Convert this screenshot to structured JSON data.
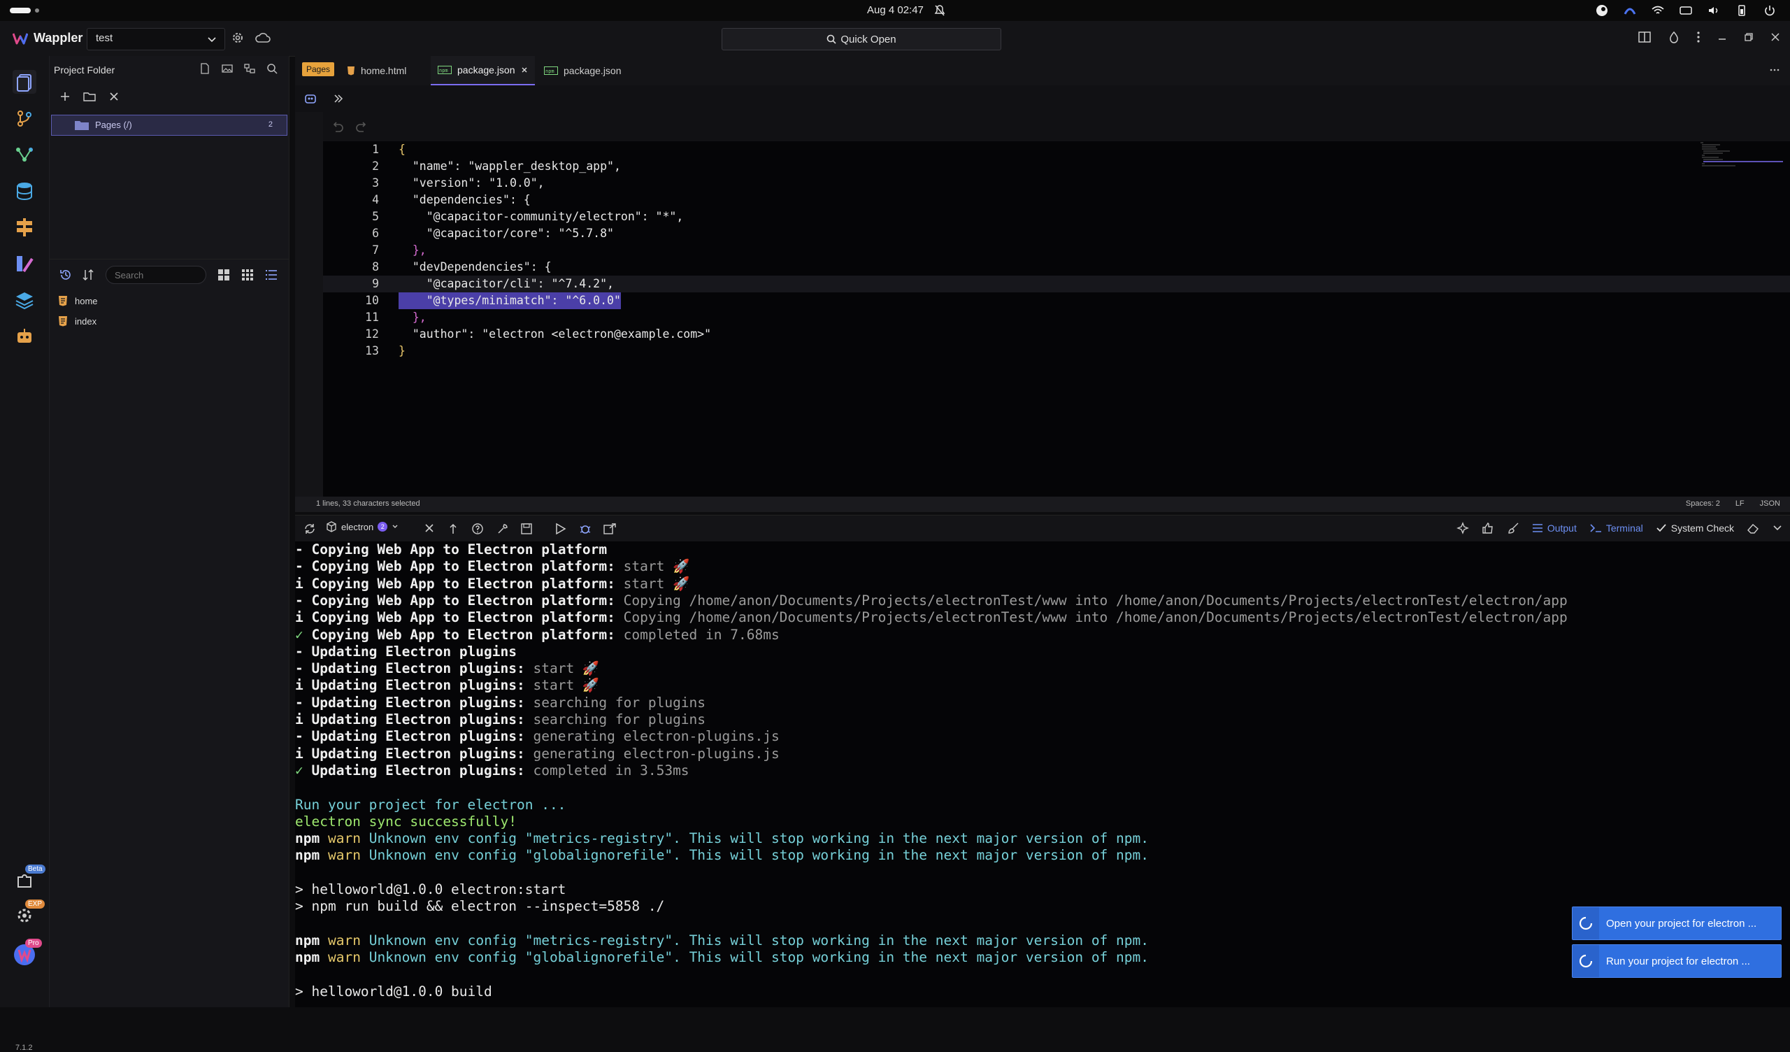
{
  "os_bar": {
    "datetime": "Aug 4  02:47"
  },
  "app": {
    "name": "Wappler",
    "version": "7.1.2"
  },
  "title_bar": {
    "project": "test",
    "quick_open": "Quick Open"
  },
  "rail": {
    "badges": {
      "extensions": "Beta",
      "settings": "EXP",
      "account": "Pro"
    }
  },
  "project_panel": {
    "title": "Project Folder",
    "tree": [
      {
        "label": "Pages (/)",
        "count": "2"
      }
    ],
    "search_placeholder": "Search",
    "files": [
      "home",
      "index"
    ]
  },
  "tabs": [
    {
      "label": "Pages",
      "type": "badge"
    },
    {
      "label": "home.html"
    },
    {
      "label": "package.json",
      "active": true
    },
    {
      "label": "package.json"
    }
  ],
  "editor": {
    "lines": [
      "{",
      "  \"name\": \"wappler_desktop_app\",",
      "  \"version\": \"1.0.0\",",
      "  \"dependencies\": {",
      "    \"@capacitor-community/electron\": \"*\",",
      "    \"@capacitor/core\": \"^5.7.8\"",
      "  },",
      "  \"devDependencies\": {",
      "    \"@capacitor/cli\": \"^7.4.2\",",
      "    \"@types/minimatch\": \"^6.0.0\"",
      "  },",
      "  \"author\": \"electron <electron@example.com>\"",
      "}"
    ],
    "line_numbers": [
      "1",
      "2",
      "3",
      "4",
      "5",
      "6",
      "7",
      "8",
      "9",
      "10",
      "11",
      "12",
      "13"
    ],
    "status_left": "1 lines, 33 characters selected",
    "status_spaces": "Spaces: 2",
    "status_eol": "LF",
    "status_lang": "JSON"
  },
  "bottom_toolbar": {
    "target": "electron",
    "target_badge": "2",
    "output": "Output",
    "terminal": "Terminal",
    "system_check": "System Check"
  },
  "terminal_lines": [
    "- Copying Web App to Electron platform",
    "- Copying Web App to Electron platform: start 🚀",
    "i Copying Web App to Electron platform: start 🚀",
    "- Copying Web App to Electron platform: Copying /home/anon/Documents/Projects/electronTest/www into /home/anon/Documents/Projects/electronTest/electron/app",
    "i Copying Web App to Electron platform: Copying /home/anon/Documents/Projects/electronTest/www into /home/anon/Documents/Projects/electronTest/electron/app",
    "✓ Copying Web App to Electron platform: completed in 7.68ms",
    "- Updating Electron plugins",
    "- Updating Electron plugins: start 🚀",
    "i Updating Electron plugins: start 🚀",
    "- Updating Electron plugins: searching for plugins",
    "i Updating Electron plugins: searching for plugins",
    "- Updating Electron plugins: generating electron-plugins.js",
    "i Updating Electron plugins: generating electron-plugins.js",
    "✓ Updating Electron plugins: completed in 3.53ms",
    "",
    "Run your project for electron ...",
    "electron sync successfully!",
    "npm warn Unknown env config \"metrics-registry\". This will stop working in the next major version of npm.",
    "npm warn Unknown env config \"globalignorefile\". This will stop working in the next major version of npm.",
    "",
    "> helloworld@1.0.0 electron:start",
    "> npm run build && electron --inspect=5858 ./",
    "",
    "npm warn Unknown env config \"metrics-registry\". This will stop working in the next major version of npm.",
    "npm warn Unknown env config \"globalignorefile\". This will stop working in the next major version of npm.",
    "",
    "> helloworld@1.0.0 build"
  ],
  "toasts": [
    "Open your project for electron ...",
    "Run your project for electron ..."
  ],
  "colors": {
    "accent": "#7b6cf0",
    "selection": "#4b3fa8",
    "toast": "#2f6fe0",
    "pages_badge": "#e6a23c"
  }
}
